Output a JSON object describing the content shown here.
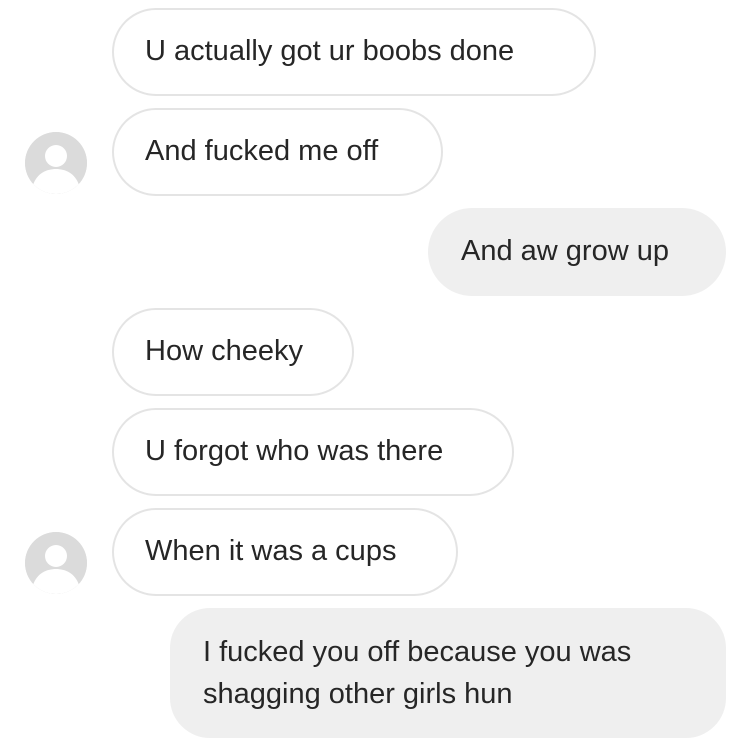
{
  "thread": {
    "messages": [
      {
        "sender": "them",
        "text": "U actually got ur boobs done"
      },
      {
        "sender": "them",
        "text": "And fucked me off"
      },
      {
        "sender": "me",
        "text": "And aw grow up"
      },
      {
        "sender": "them",
        "text": "How cheeky"
      },
      {
        "sender": "them",
        "text": "U forgot who was there"
      },
      {
        "sender": "them",
        "text": "When it was a cups"
      },
      {
        "sender": "me",
        "text": "I fucked you off because you was shagging other girls  hun"
      }
    ]
  },
  "colors": {
    "incoming_bubble_bg": "#ffffff",
    "incoming_bubble_border": "#e4e4e4",
    "outgoing_bubble_bg": "#efefef",
    "avatar_placeholder": "#dbdbdb",
    "text": "#262626"
  },
  "icons": {
    "avatar": "default-profile-avatar-icon"
  }
}
